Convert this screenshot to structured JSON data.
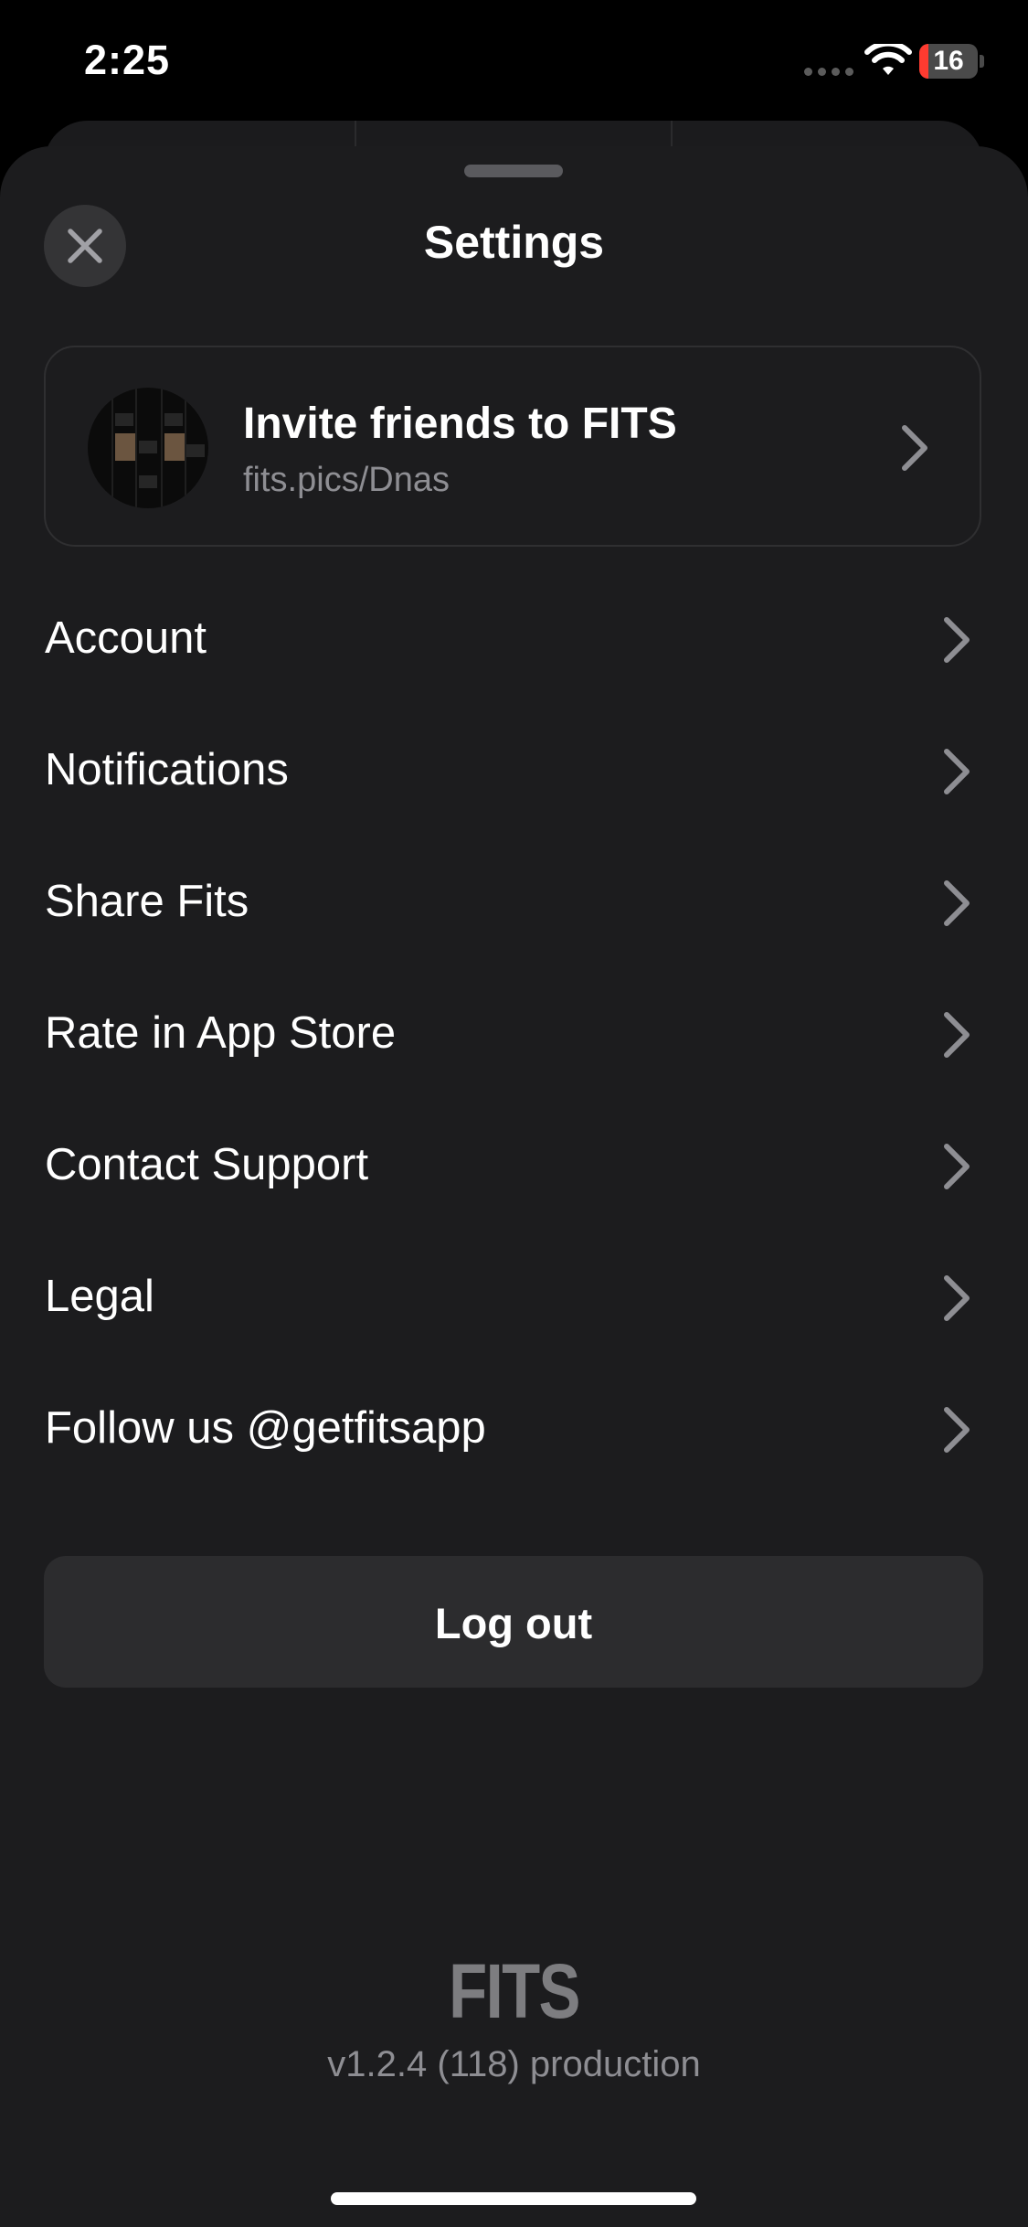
{
  "status_bar": {
    "time": "2:25",
    "battery_level": "16",
    "battery_fraction": 0.16,
    "icons": [
      "signal-dots-icon",
      "wifi-icon",
      "battery-icon"
    ]
  },
  "sheet": {
    "title": "Settings",
    "close_icon": "close-icon"
  },
  "invite": {
    "title": "Invite friends to FITS",
    "link": "fits.pics/Dnas",
    "chevron_icon": "chevron-right-icon"
  },
  "menu": {
    "items": [
      {
        "label": "Account"
      },
      {
        "label": "Notifications"
      },
      {
        "label": "Share Fits"
      },
      {
        "label": "Rate in App Store"
      },
      {
        "label": "Contact Support"
      },
      {
        "label": "Legal"
      },
      {
        "label": "Follow us @getfitsapp"
      }
    ]
  },
  "logout": {
    "label": "Log out"
  },
  "footer": {
    "brand": "FITS",
    "version": "v1.2.4 (118) production"
  },
  "colors": {
    "background": "#000000",
    "sheet": "#1c1c1e",
    "button": "#2c2c2e",
    "secondary_text": "#8e8e93",
    "chevron": "#8e8e93",
    "battery_low": "#ff3b30"
  }
}
